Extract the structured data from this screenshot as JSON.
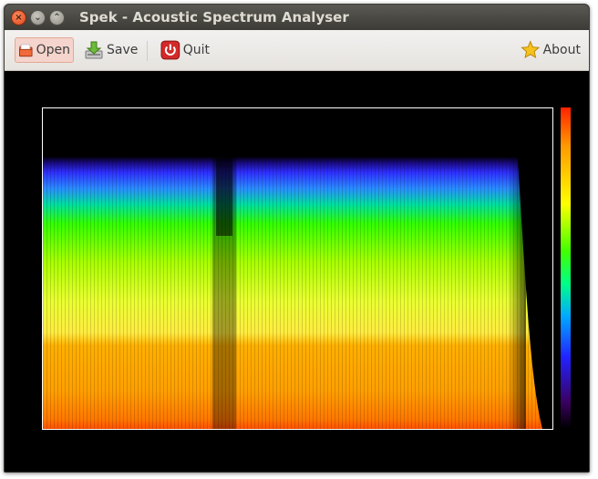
{
  "window": {
    "title": "Spek - Acoustic Spectrum Analyser",
    "buttons": {
      "close": "×",
      "minimize": "⌄",
      "maximize": "⌃"
    }
  },
  "toolbar": {
    "open_label": "Open",
    "save_label": "Save",
    "quit_label": "Quit",
    "about_label": "About"
  },
  "icons": {
    "open": "folder-icon",
    "save": "save-icon",
    "quit": "power-icon",
    "about": "star-icon"
  },
  "colors": {
    "titlebar": "#3c3b37",
    "toolbar": "#f2f1f0",
    "canvas_bg": "#000000",
    "open_pressed_bg": "#f4d4cc"
  }
}
